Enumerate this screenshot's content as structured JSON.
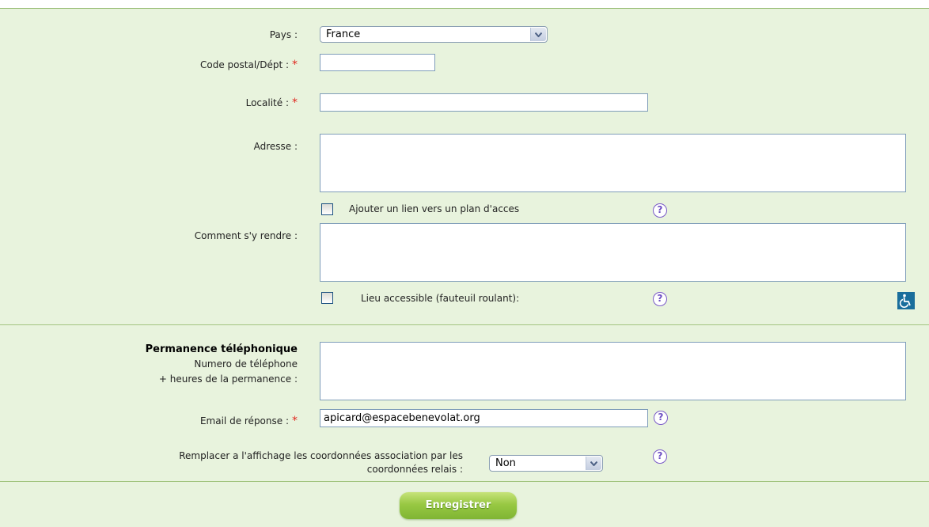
{
  "fields": {
    "pays": {
      "label": "Pays :",
      "value": "France"
    },
    "code_postal": {
      "label": "Code postal/Dépt :",
      "required": "*",
      "value": ""
    },
    "localite": {
      "label": "Localité :",
      "required": "*",
      "value": ""
    },
    "adresse": {
      "label": "Adresse :",
      "value": ""
    },
    "plan_acces": {
      "label": "Ajouter un lien vers un plan d'acces",
      "help": "?"
    },
    "comment_sy_rendre": {
      "label": "Comment s'y rendre :",
      "value": ""
    },
    "lieu_accessible": {
      "label": "Lieu accessible (fauteuil roulant):",
      "help": "?",
      "icon": "wheelchair-icon"
    },
    "permanence": {
      "title": "Permanence téléphonique",
      "line1": "Numero de téléphone",
      "line2": "+ heures de la permanence :",
      "value": ""
    },
    "email": {
      "label": "Email de réponse :",
      "required": "*",
      "value": "apicard@espacebenevolat.org",
      "help": "?"
    },
    "remplacer": {
      "line1": "Remplacer a l'affichage les coordonnées association par les",
      "line2": "coordonnées relais :",
      "value": "Non",
      "help": "?"
    }
  },
  "submit": {
    "label": "Enregistrer"
  },
  "colors": {
    "background": "#e8f3dd",
    "separator": "#a2c47f",
    "required": "#e0281f",
    "button": "#98c843",
    "help": "#7a5ac8"
  }
}
